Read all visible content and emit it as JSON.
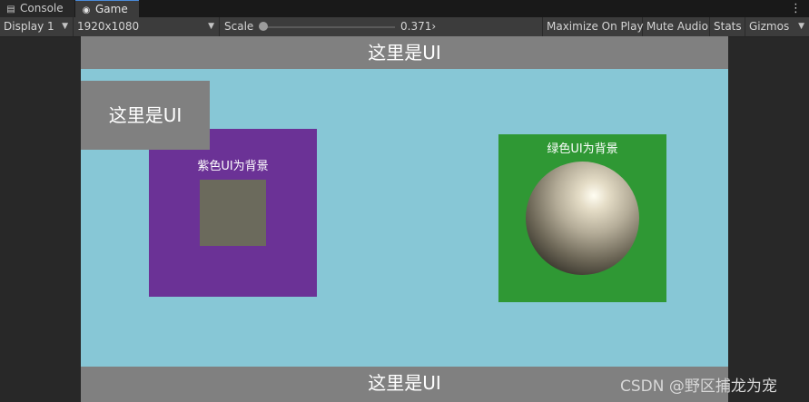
{
  "tabs": [
    {
      "label": "Console",
      "icon": "console-icon"
    },
    {
      "label": "Game",
      "icon": "gamepad-icon"
    }
  ],
  "toolbar": {
    "display": "Display 1",
    "resolution": "1920x1080",
    "scale_label": "Scale",
    "scale_value": "0.371›",
    "maximize": "Maximize On Play",
    "mute": "Mute Audio",
    "stats": "Stats",
    "gizmos": "Gizmos"
  },
  "game": {
    "top_banner": "这里是UI",
    "float_label": "这里是UI",
    "purple_panel_label": "紫色UI为背景",
    "green_panel_label": "绿色UI为背景",
    "bottom_banner": "这里是UI"
  },
  "colors": {
    "sky": "#87c7d6",
    "banner": "#808080",
    "purple": "#6b3296",
    "green": "#2f9834"
  },
  "watermark": "CSDN @野区捕龙为宠"
}
